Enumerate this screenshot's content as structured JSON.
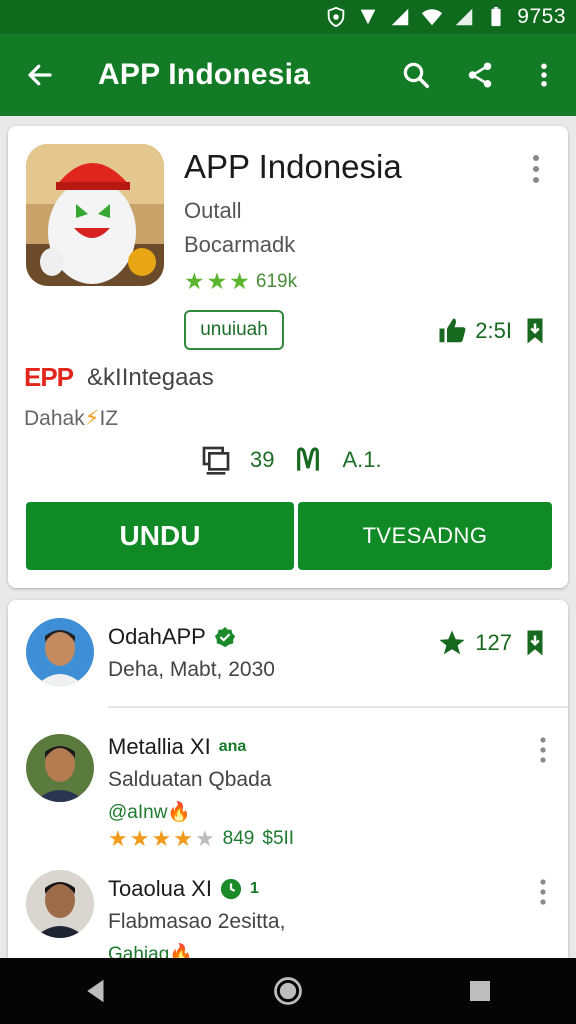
{
  "status_bar": {
    "time": "9753",
    "icons": [
      "shield-icon",
      "signal-icon",
      "wifi-icon",
      "battery-icon"
    ]
  },
  "app_bar": {
    "title": "APP Indonesia",
    "icons": [
      "back-arrow-icon",
      "search-icon",
      "share-icon",
      "more-vert-icon"
    ],
    "background": "#137b26"
  },
  "app_card": {
    "name": "APP Indonesia",
    "developer": "Outall",
    "category": "Bocarmadk",
    "rating_count": "619k",
    "install_chip": "unuiuah",
    "likes": "2:5I",
    "publisher_logo": "EPP",
    "publisher_name": "&kIIntegaas",
    "publisher_sub": "Dahak",
    "publisher_sub_suffix": "IZ",
    "stat_1": "39",
    "stat_2": "A.1.",
    "primary_button": "UNDU",
    "secondary_button": "TVESADNG",
    "button_color": "#0f8a24"
  },
  "reviews": [
    {
      "name": "OdahAPP",
      "line1": "Deha, Mabt, 2030",
      "stat": "127"
    },
    {
      "name": "Metallia XI",
      "tag": "ana",
      "line1": "Salduatan Qbada",
      "green": "@aInw",
      "stars_text": "849",
      "stars_suffix": "$5II",
      "stars_value": 4
    },
    {
      "name": "Toaolua XI",
      "tag": "1",
      "line1": "Flabmasao 2esitta,",
      "green": "Gahiag"
    }
  ],
  "nav_bar": {
    "icons": [
      "back-triangle-icon",
      "home-circle-icon",
      "recents-square-icon"
    ]
  }
}
